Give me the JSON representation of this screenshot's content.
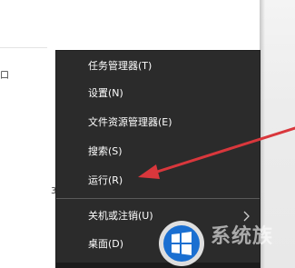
{
  "context_menu": {
    "items": [
      {
        "id": "task-manager",
        "label": "任务管理器(T)"
      },
      {
        "id": "settings",
        "label": "设置(N)"
      },
      {
        "id": "file-explorer",
        "label": "文件资源管理器(E)"
      },
      {
        "id": "search",
        "label": "搜索(S)"
      },
      {
        "id": "run",
        "label": "运行(R)"
      },
      {
        "id": "shutdown",
        "label": "关机或注销(U)",
        "has_submenu": true
      },
      {
        "id": "desktop",
        "label": "桌面(D)"
      }
    ],
    "submenu_arrow_icon": "chevron-right-icon"
  },
  "left_panel": {
    "glyph_top": "口",
    "glyph_bottom": "3"
  },
  "annotation": {
    "arrow_color": "#d9373c",
    "points_to": "run"
  },
  "watermark": {
    "logo_icon": "windows-logo-icon",
    "text": "系统族"
  },
  "colors": {
    "menu_bg": "#2b2b2b",
    "menu_text": "#ffffff",
    "separator": "#5a5a5a",
    "arrow": "#d9373c"
  }
}
